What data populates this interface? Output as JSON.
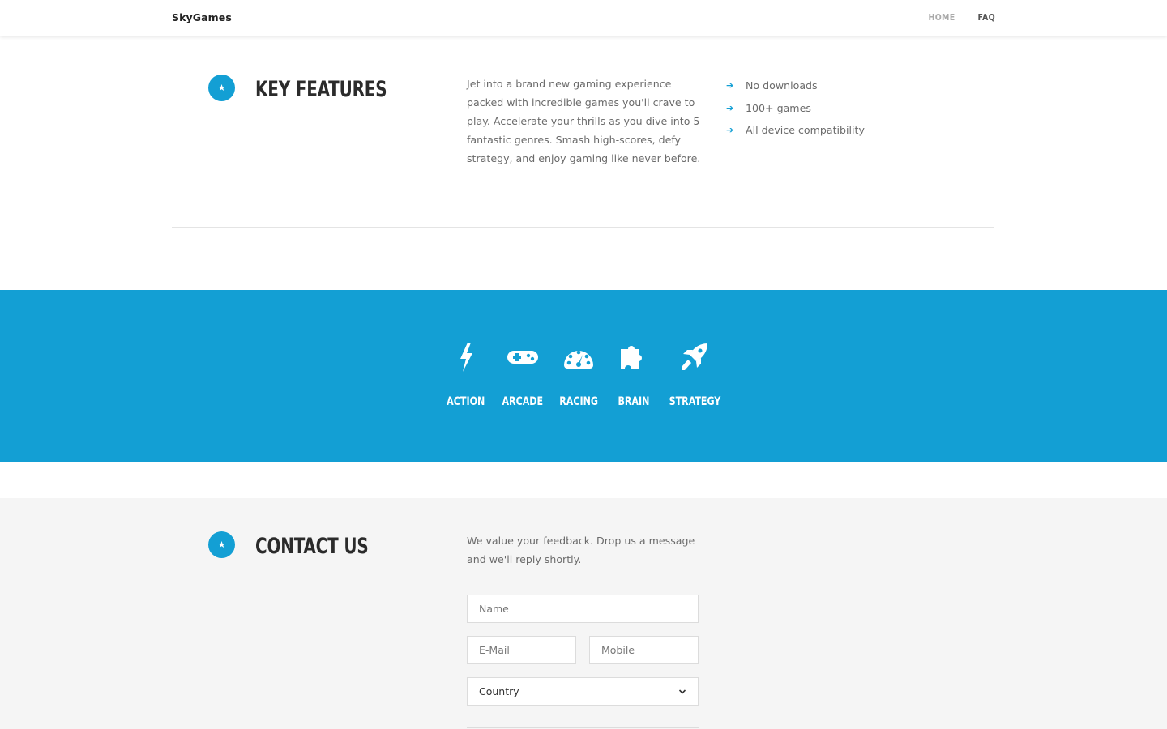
{
  "header": {
    "brand": "SkyGames",
    "nav": [
      {
        "label": "HOME"
      },
      {
        "label": "FAQ"
      }
    ]
  },
  "features": {
    "badge_icon": "star-icon",
    "title": "KEY FEATURES",
    "description_lines": [
      "Jet into a brand new gaming experience",
      "packed with incredible games you'll crave to",
      "play. Accelerate your thrills as you dive into 5",
      "fantastic genres. Smash high-scores, defy",
      "strategy, and enjoy gaming like never before."
    ],
    "list": [
      "No downloads",
      "100+ games",
      "All device compatibility"
    ]
  },
  "genres": [
    {
      "label": "ACTION",
      "icon": "lightning-icon"
    },
    {
      "label": "ARCADE",
      "icon": "gamepad-icon"
    },
    {
      "label": "RACING",
      "icon": "speedometer-icon"
    },
    {
      "label": "BRAIN",
      "icon": "puzzle-icon"
    },
    {
      "label": "STRATEGY",
      "icon": "rocket-icon"
    }
  ],
  "contact": {
    "badge_icon": "star-icon",
    "title": "CONTACT US",
    "intro_lines": [
      "We value your feedback. Drop us a message",
      "and we'll reply shortly."
    ],
    "form": {
      "name_placeholder": "Name",
      "email_placeholder": "E-Mail",
      "mobile_placeholder": "Mobile",
      "country_selected": "Country"
    }
  },
  "colors": {
    "accent": "#139fd4",
    "band_text": "#ffffff",
    "heading": "#2b2b2b",
    "body_text": "#6b6b6b",
    "contact_bg": "#f5f5f5"
  }
}
